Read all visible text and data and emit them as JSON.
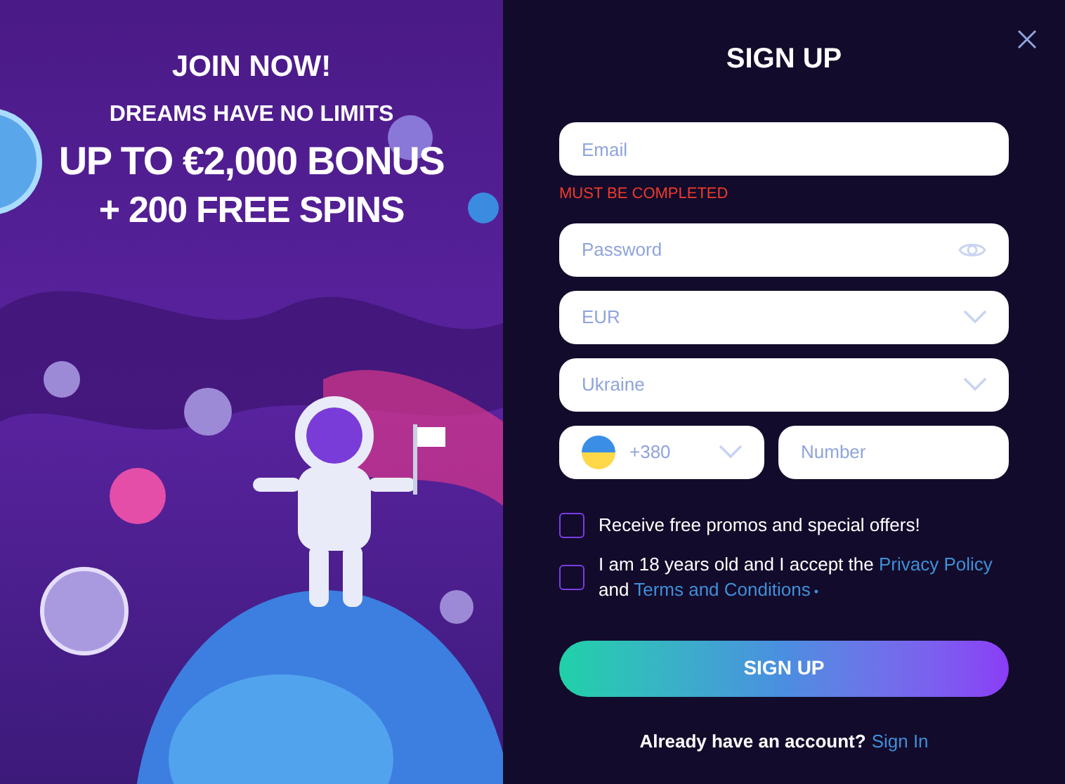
{
  "promo": {
    "title": "JOIN NOW!",
    "subtitle": "DREAMS HAVE NO LIMITS",
    "headline": "UP TO €2,000 BONUS",
    "headline2": "+ 200 FREE SPINS"
  },
  "form": {
    "title": "SIGN UP",
    "fields": [
      {
        "kind": "input",
        "placeholder": "Email",
        "error": "MUST BE COMPLETED"
      },
      {
        "kind": "password",
        "placeholder": "Password"
      },
      {
        "kind": "select",
        "value": "EUR"
      },
      {
        "kind": "select",
        "value": "Ukraine"
      }
    ],
    "phone": {
      "code": "+380",
      "placeholder": "Number"
    },
    "checkboxes": [
      {
        "checked": false,
        "text": "Receive free promos and special offers!"
      },
      {
        "checked": false,
        "text": "I am 18 years old and I accept the",
        "link": "Privacy Policy",
        "text2": "and",
        "link2": "Terms and Conditions",
        "mark": "•"
      }
    ],
    "submit": "SIGN UP",
    "footer": {
      "text": "Already have an account?",
      "link": "Sign In"
    }
  }
}
